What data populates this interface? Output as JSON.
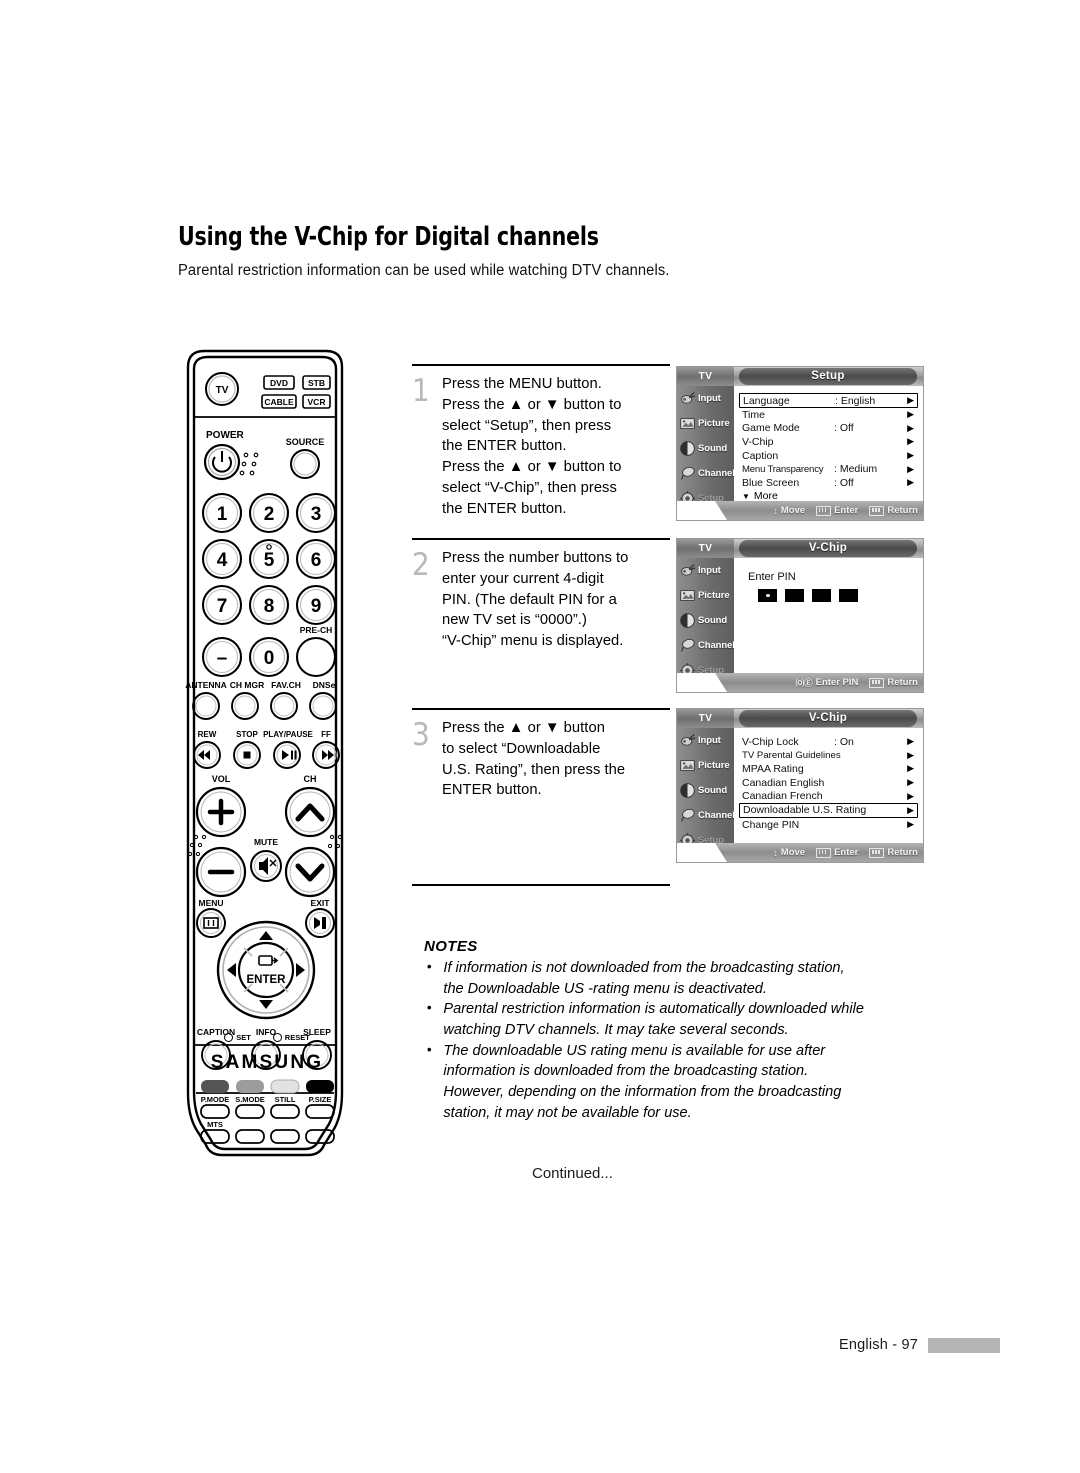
{
  "page": {
    "title": "Using the V-Chip for Digital channels",
    "subtitle": "Parental restriction information can be used while watching DTV channels.",
    "continued": "Continued...",
    "footer_page": "English - 97"
  },
  "steps": [
    {
      "number": "1",
      "lines": [
        "Press the MENU button.",
        "Press the ▲ or ▼ button to",
        "select “Setup”, then press",
        "the ENTER button.",
        "Press the ▲ or ▼ button to",
        "select “V-Chip”, then press",
        "the ENTER button."
      ]
    },
    {
      "number": "2",
      "lines": [
        "Press the number buttons to",
        "enter your current 4-digit",
        "PIN. (The default PIN for a",
        "new TV set is “0000”.)",
        "“V-Chip” menu is displayed."
      ]
    },
    {
      "number": "3",
      "lines": [
        "Press the ▲ or ▼ button",
        "to select “Downloadable",
        "U.S. Rating”, then press the",
        "ENTER button."
      ]
    }
  ],
  "osd_sidebar": [
    {
      "label": "Input",
      "icon": "input-icon",
      "dim": false
    },
    {
      "label": "Picture",
      "icon": "picture-icon",
      "dim": false
    },
    {
      "label": "Sound",
      "icon": "sound-icon",
      "dim": false
    },
    {
      "label": "Channel",
      "icon": "channel-icon",
      "dim": false
    },
    {
      "label": "Setup",
      "icon": "setup-icon",
      "dim": true
    }
  ],
  "osd_screens": [
    {
      "source_label": "TV",
      "title": "Setup",
      "rows": [
        {
          "label": "Language",
          "value": ": English",
          "arrow": "▶",
          "selected": true
        },
        {
          "label": "Time",
          "value": "",
          "arrow": "▶",
          "selected": false
        },
        {
          "label": "Game Mode",
          "value": ": Off",
          "arrow": "▶",
          "selected": false
        },
        {
          "label": "V-Chip",
          "value": "",
          "arrow": "▶",
          "selected": false
        },
        {
          "label": "Caption",
          "value": "",
          "arrow": "▶",
          "selected": false
        },
        {
          "label": "Menu Transparency",
          "value": ": Medium",
          "arrow": "▶",
          "selected": false
        },
        {
          "label": "Blue Screen",
          "value": ": Off",
          "arrow": "▶",
          "selected": false
        }
      ],
      "more_label": "More",
      "more_arrow": "▼",
      "hints": [
        {
          "icon": "↕",
          "label": "Move"
        },
        {
          "icon": "enter-box",
          "label": "Enter"
        },
        {
          "icon": "return-box",
          "label": "Return"
        }
      ]
    },
    {
      "source_label": "TV",
      "title": "V-Chip",
      "pin_label": "Enter PIN",
      "pin_boxes": [
        "filled",
        "empty",
        "empty",
        "empty"
      ],
      "hints": [
        {
          "icon": "⒪Ⓔ",
          "label": "Enter PIN"
        },
        {
          "icon": "return-box",
          "label": "Return"
        }
      ]
    },
    {
      "source_label": "TV",
      "title": "V-Chip",
      "rows": [
        {
          "label": "V-Chip Lock",
          "value": ": On",
          "arrow": "▶",
          "selected": false
        },
        {
          "label": "TV Parental Guidelines",
          "value": "",
          "arrow": "▶",
          "selected": false
        },
        {
          "label": "MPAA Rating",
          "value": "",
          "arrow": "▶",
          "selected": false
        },
        {
          "label": "Canadian English",
          "value": "",
          "arrow": "▶",
          "selected": false
        },
        {
          "label": "Canadian French",
          "value": "",
          "arrow": "▶",
          "selected": false
        },
        {
          "label": "Downloadable U.S. Rating",
          "value": "",
          "arrow": "▶",
          "selected": true
        },
        {
          "label": "Change PIN",
          "value": "",
          "arrow": "▶",
          "selected": false
        }
      ],
      "hints": [
        {
          "icon": "↕",
          "label": "Move"
        },
        {
          "icon": "enter-box",
          "label": "Enter"
        },
        {
          "icon": "return-box",
          "label": "Return"
        }
      ]
    }
  ],
  "notes": {
    "heading": "NOTES",
    "items": [
      [
        "If information is not downloaded from the broadcasting station,",
        "the Downloadable US -rating menu is deactivated."
      ],
      [
        "Parental restriction information is automatically downloaded while",
        "watching DTV channels. It may take several seconds."
      ],
      [
        "The downloadable US rating menu is available for use after",
        "information is downloaded from the broadcasting station.",
        "However, depending on the information from the broadcasting",
        "station, it may not be available for use."
      ]
    ]
  },
  "remote": {
    "brand": "SAMSUNG",
    "mode_buttons": [
      "TV",
      "DVD",
      "STB",
      "CABLE",
      "VCR"
    ],
    "power_label": "POWER",
    "source_label": "SOURCE",
    "number_keys": [
      "1",
      "2",
      "3",
      "4",
      "5",
      "6",
      "7",
      "8",
      "9",
      "–",
      "0"
    ],
    "pre_ch_label": "PRE-CH",
    "func_row": [
      "ANTENNA",
      "CH MGR",
      "FAV.CH",
      "DNSe"
    ],
    "transport_row": [
      "REW",
      "STOP",
      "PLAY/PAUSE",
      "FF"
    ],
    "vol_label": "VOL",
    "ch_label": "CH",
    "mute_label": "MUTE",
    "menu_label": "MENU",
    "exit_label": "EXIT",
    "enter_label": "ENTER",
    "bottom_row": [
      "CAPTION",
      "INFO",
      "SLEEP"
    ],
    "color_row": [
      "P.MODE",
      "S.MODE",
      "STILL",
      "P.SIZE"
    ],
    "mts_label": "MTS",
    "set_label": "SET",
    "reset_label": "RESET"
  },
  "colors": {
    "ink": "#000000",
    "step_number": "#b9b9b9",
    "footer_bar": "#b5b5b5",
    "osd_white": "#ffffff",
    "osd_gray": "#8d8d8d"
  }
}
